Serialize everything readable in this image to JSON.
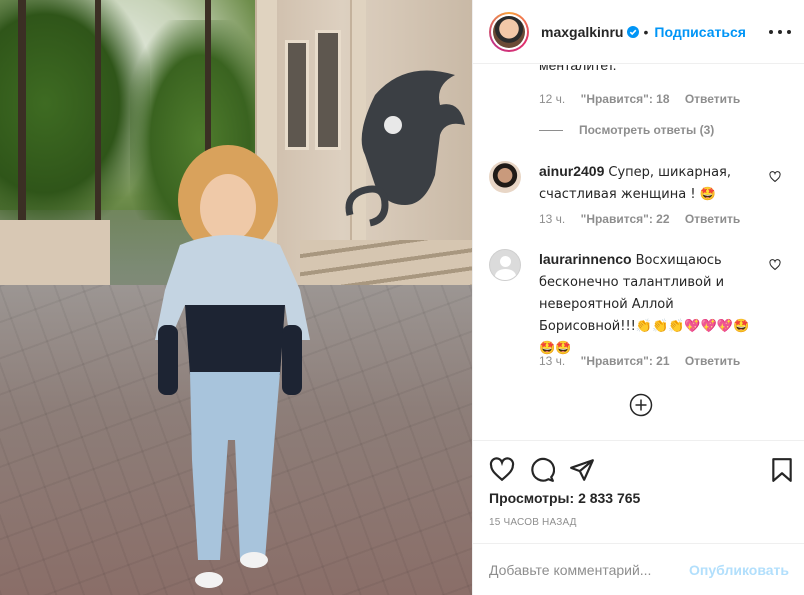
{
  "post": {
    "username": "maxgalkinru",
    "follow_label": "Подписаться",
    "dot": "•"
  },
  "comments": {
    "truncated_text": "менталитет.",
    "first_meta": {
      "time": "12 ч.",
      "likes": "\"Нравится\": 18",
      "reply": "Ответить"
    },
    "view_replies": "Посмотреть ответы (3)",
    "items": [
      {
        "username": "ainur2409",
        "text": "Супер, шикарная, счастливая женщина ! 🤩",
        "time": "13 ч.",
        "likes": "\"Нравится\": 22",
        "reply": "Ответить"
      },
      {
        "username": "laurarinnenco",
        "text": "Восхищаюсь бесконечно талантливой и невероятной Аллой Бориcовной!!!👏👏👏💖💖💖🤩🤩🤩",
        "time": "13 ч.",
        "likes": "\"Нравится\": 21",
        "reply": "Ответить"
      }
    ]
  },
  "actions": {
    "views_label": "Просмотры:",
    "views_count": "2 833 765",
    "time_ago": "15 ЧАСОВ НАЗАД"
  },
  "comment_box": {
    "placeholder": "Добавьте комментарий...",
    "post_label": "Опубликовать"
  },
  "colors": {
    "accent": "#0095f6",
    "muted": "#8e8e8e",
    "text": "#262626",
    "post_disabled": "#b2dffc"
  },
  "icons": [
    "verified-badge-icon",
    "more-options-icon",
    "heart-icon",
    "comment-icon",
    "share-icon",
    "bookmark-icon",
    "add-circle-icon"
  ]
}
